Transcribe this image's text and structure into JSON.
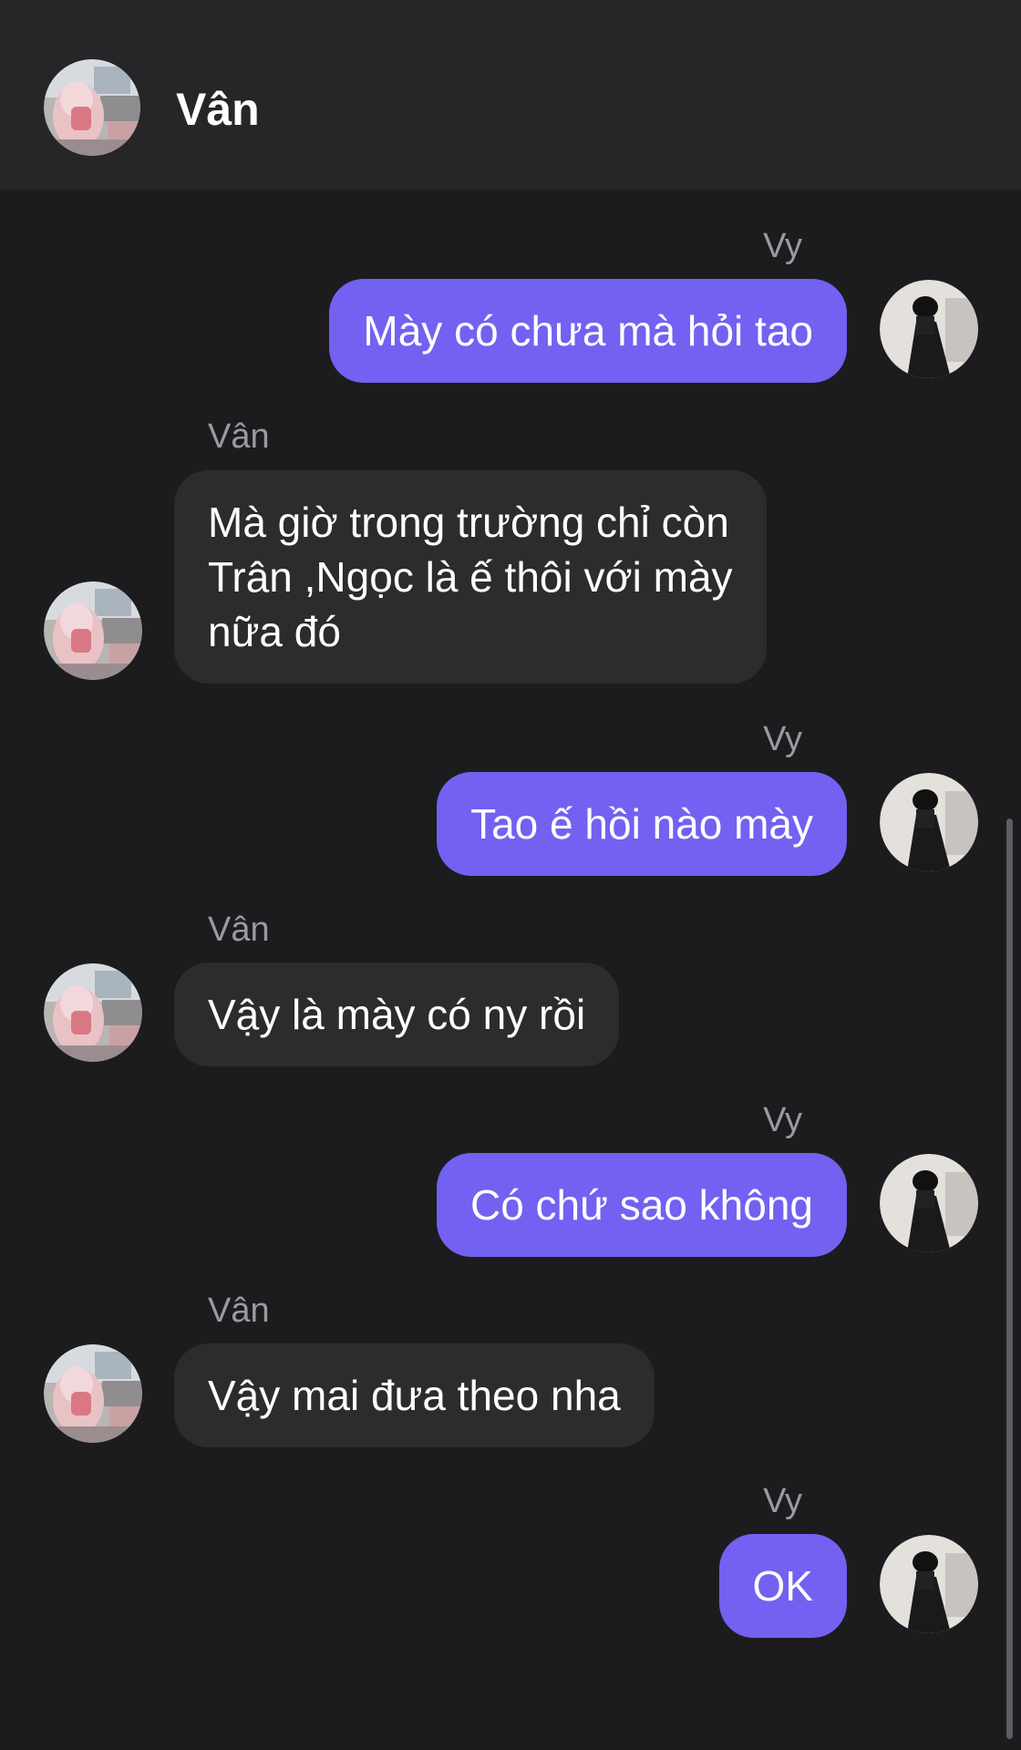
{
  "header": {
    "contact_name": "Vân",
    "avatar_icon": "profile-photo-avatar"
  },
  "colors": {
    "background": "#1c1c1e",
    "header_background": "#262628",
    "outgoing_bubble": "#7361f2",
    "incoming_bubble": "#2c2c2e",
    "sender_name": "#9a9aa0"
  },
  "messages": [
    {
      "sender": "Vy",
      "direction": "outgoing",
      "text": "Mày có chưa mà hỏi tao"
    },
    {
      "sender": "Vân",
      "direction": "incoming",
      "text": "Mà giờ trong trường chỉ còn\nTrân ,Ngọc là ế thôi với mày\nnữa đó"
    },
    {
      "sender": "Vy",
      "direction": "outgoing",
      "text": "Tao ế hồi nào mày"
    },
    {
      "sender": "Vân",
      "direction": "incoming",
      "text": "Vậy là mày có ny rồi"
    },
    {
      "sender": "Vy",
      "direction": "outgoing",
      "text": "Có chứ sao không"
    },
    {
      "sender": "Vân",
      "direction": "incoming",
      "text": "Vậy mai đưa theo nha"
    },
    {
      "sender": "Vy",
      "direction": "outgoing",
      "text": "OK"
    }
  ]
}
